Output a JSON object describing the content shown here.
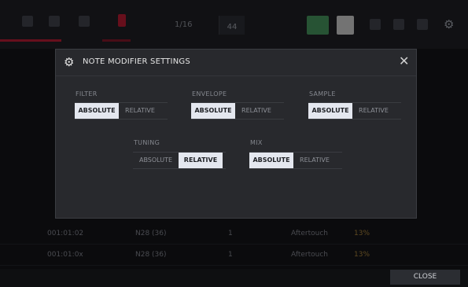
{
  "topbar": {
    "step_text": "1/16",
    "bpm_label": "44"
  },
  "background_rows": [
    {
      "time": "001:01:02",
      "note": "N28 (36)",
      "value": "1",
      "type": "Aftertouch",
      "level": "13%"
    },
    {
      "time": "001:01:0x",
      "note": "N28 (36)",
      "value": "1",
      "type": "Aftertouch",
      "level": "13%"
    }
  ],
  "dialog": {
    "title": "NOTE MODIFIER SETTINGS",
    "close_symbol": "✕",
    "gear_symbol": "⚙",
    "groups": [
      {
        "label": "FILTER",
        "options": [
          "ABSOLUTE",
          "RELATIVE"
        ],
        "selected": "ABSOLUTE"
      },
      {
        "label": "ENVELOPE",
        "options": [
          "ABSOLUTE",
          "RELATIVE"
        ],
        "selected": "ABSOLUTE"
      },
      {
        "label": "SAMPLE",
        "options": [
          "ABSOLUTE",
          "RELATIVE"
        ],
        "selected": "ABSOLUTE"
      },
      {
        "label": "TUNING",
        "options": [
          "ABSOLUTE",
          "RELATIVE"
        ],
        "selected": "RELATIVE"
      },
      {
        "label": "MIX",
        "options": [
          "ABSOLUTE",
          "RELATIVE"
        ],
        "selected": "ABSOLUTE"
      }
    ]
  },
  "footer": {
    "close_label": "CLOSE"
  },
  "colors": {
    "accent_red": "#b3142a",
    "selected_option": "#e4e7ef",
    "dialog_bg": "#28292d"
  }
}
